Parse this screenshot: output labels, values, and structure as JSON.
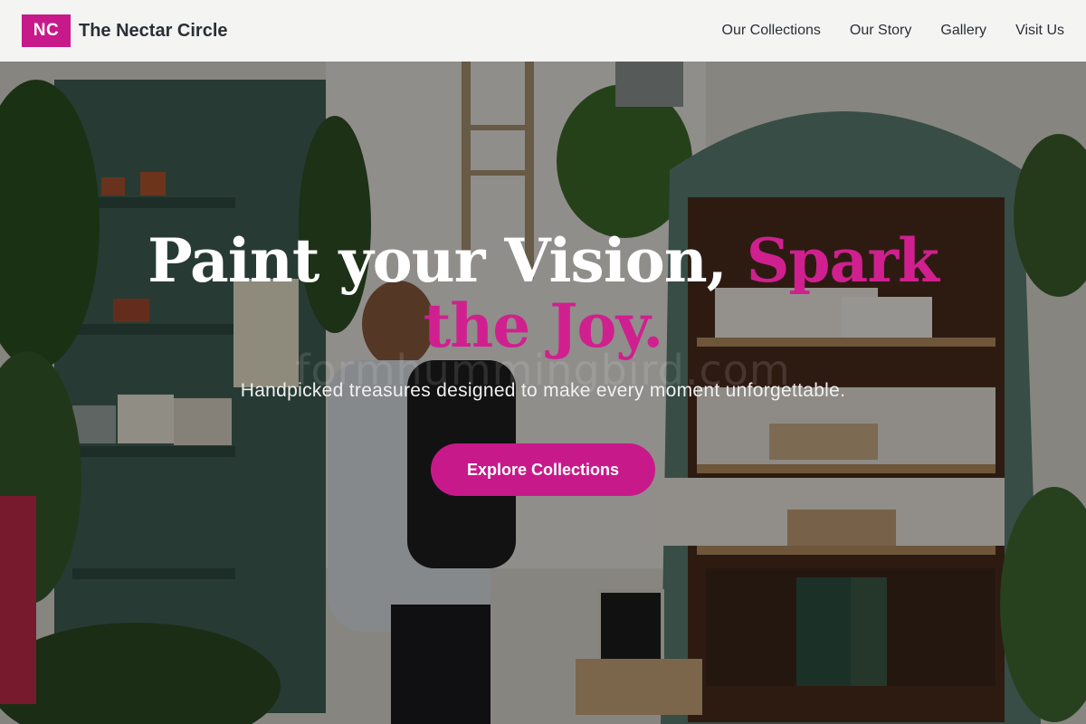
{
  "header": {
    "logo_initials": "NC",
    "brand_name": "The Nectar Circle",
    "nav": [
      {
        "label": "Our Collections"
      },
      {
        "label": "Our Story"
      },
      {
        "label": "Gallery"
      },
      {
        "label": "Visit Us"
      }
    ]
  },
  "hero": {
    "headline_part1": "Paint your Vision,",
    "headline_part2": "Spark the Joy.",
    "subtitle": "Handpicked treasures designed to make every moment unforgettable.",
    "cta_label": "Explore Collections",
    "watermark": "formhummingbird.com"
  },
  "colors": {
    "accent": "#c8198a",
    "header_bg": "#f4f4f3",
    "text_dark": "#2b2f36"
  }
}
